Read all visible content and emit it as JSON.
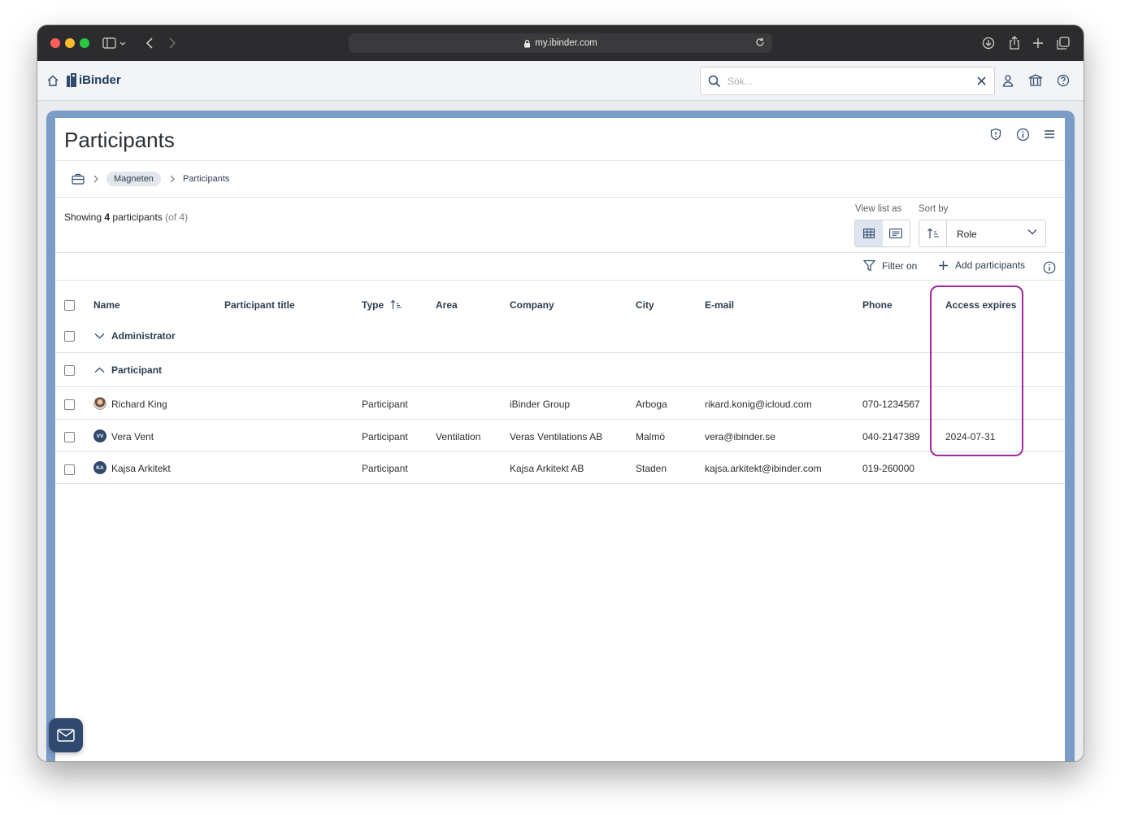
{
  "browser": {
    "url": "my.ibinder.com"
  },
  "app": {
    "logo_text": "iBinder",
    "search_placeholder": "Sök..."
  },
  "page": {
    "title": "Participants",
    "breadcrumb": [
      "Magneten",
      "Participants"
    ],
    "showing_prefix": "Showing",
    "showing_count": "4",
    "showing_suffix": "participants",
    "showing_total": "(of 4)",
    "view_list_as_label": "View list as",
    "sort_by_label": "Sort by",
    "sort_value": "Role",
    "filter_label": "Filter on",
    "add_label": "Add participants"
  },
  "table": {
    "columns": [
      "Name",
      "Participant title",
      "Type",
      "Area",
      "Company",
      "City",
      "E-mail",
      "Phone",
      "Access expires"
    ],
    "groups": [
      "Administrator",
      "Participant"
    ],
    "rows": [
      {
        "initials": "",
        "name": "Richard King",
        "title": "",
        "type": "Participant",
        "area": "",
        "company": "iBinder Group",
        "city": "Arboga",
        "email": "rikard.konig@icloud.com",
        "phone": "070-1234567",
        "expires": ""
      },
      {
        "initials": "VV",
        "name": "Vera Vent",
        "title": "",
        "type": "Participant",
        "area": "Ventilation",
        "company": "Veras Ventilations AB",
        "city": "Malmö",
        "email": "vera@ibinder.se",
        "phone": "040-2147389",
        "expires": "2024-07-31"
      },
      {
        "initials": "KA",
        "name": "Kajsa Arkitekt",
        "title": "",
        "type": "Participant",
        "area": "",
        "company": "Kajsa Arkitekt AB",
        "city": "Staden",
        "email": "kajsa.arkitekt@ibinder.com",
        "phone": "019-260000",
        "expires": ""
      }
    ]
  },
  "colors": {
    "frame": "#7a9cc6",
    "primary": "#2f4a6e",
    "highlight": "#a3279c"
  }
}
